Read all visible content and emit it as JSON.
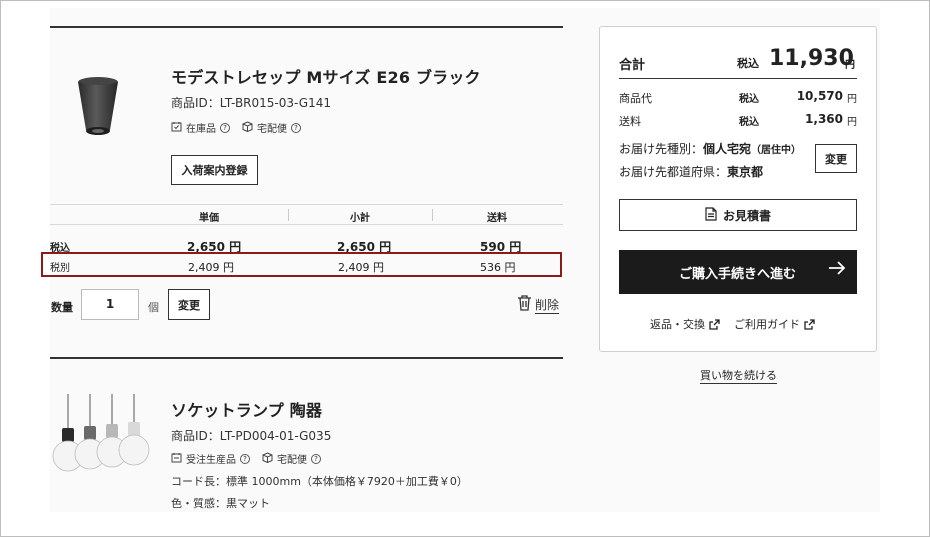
{
  "products": [
    {
      "name": "モデストレセップ Mサイズ E26 ブラック",
      "id": "商品ID：LT-BR015-03-G141",
      "stock": "在庫品",
      "delivery": "宅配便",
      "notify_button": "入荷案内登録",
      "image": "black-socket-image"
    },
    {
      "name": "ソケットランプ 陶器",
      "id": "商品ID：LT-PD004-01-G035",
      "stock": "受注生産品",
      "delivery": "宅配便",
      "cord": "コード長：標準 1000mm（本体価格￥7920＋加工費￥0）",
      "color": "色・質感：黒マット",
      "image": "socket-lamps-image"
    }
  ],
  "price_table": {
    "headers": [
      "単価",
      "小計",
      "送料"
    ],
    "rows": [
      {
        "label": "税込",
        "unit": "2,650 円",
        "subtotal": "2,650 円",
        "shipping": "590 円"
      },
      {
        "label": "税別",
        "unit": "2,409 円",
        "subtotal": "2,409 円",
        "shipping": "536 円"
      }
    ]
  },
  "quantity": {
    "label": "数量",
    "value": "1",
    "unit": "個",
    "change_button": "変更",
    "delete_label": "削除"
  },
  "summary": {
    "total_label": "合計",
    "tax_label": "税込",
    "total_value": "11,930",
    "yen": "円",
    "lines": [
      {
        "label": "商品代",
        "tax": "税込",
        "value": "10,570",
        "yen": "円"
      },
      {
        "label": "送料",
        "tax": "税込",
        "value": "1,360",
        "yen": "円"
      }
    ],
    "dest_type_label": "お届け先種別：",
    "dest_type_value": "個人宅宛",
    "dest_type_note": "（居住中）",
    "dest_pref_label": "お届け先都道府県：",
    "dest_pref_value": "東京都",
    "change_button": "変更",
    "quote_button": "お見積書",
    "checkout_button": "ご購入手続きへ進む",
    "link_returns": "返品・交換",
    "link_guide": "ご利用ガイド",
    "continue_link": "買い物を続ける"
  },
  "colors": {
    "highlight": "#8b1a1a",
    "checkout_bg": "#1b1b1b"
  }
}
